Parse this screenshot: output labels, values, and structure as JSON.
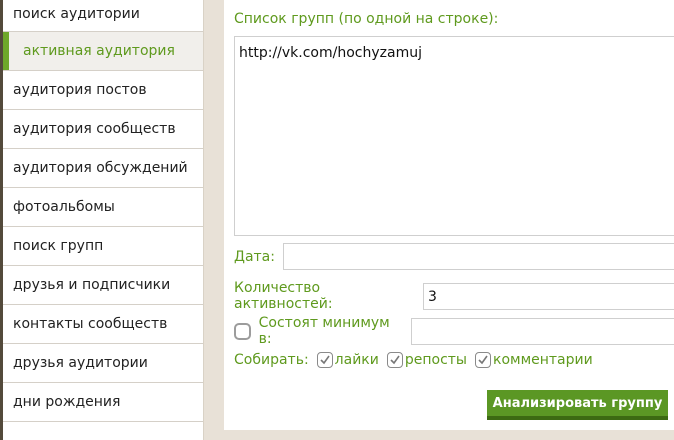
{
  "sidebar": {
    "items": [
      {
        "label": "поиск аудитории"
      },
      {
        "label": "активная аудитория"
      },
      {
        "label": "аудитория постов"
      },
      {
        "label": "аудитория сообществ"
      },
      {
        "label": "аудитория обсуждений"
      },
      {
        "label": "фотоальбомы"
      },
      {
        "label": "поиск групп"
      },
      {
        "label": "друзья и подписчики"
      },
      {
        "label": "контакты сообществ"
      },
      {
        "label": "друзья аудитории"
      },
      {
        "label": "дни рождения"
      },
      {
        "label": ""
      }
    ]
  },
  "form": {
    "list_label": "Список групп (по одной на строке):",
    "list_value": "http://vk.com/hochyzamuj",
    "date_label": "Дата:",
    "date_value": "",
    "activity_label": "Количество активностей:",
    "activity_value": "3",
    "min_label": "Состоят минимум в:",
    "min_value": "",
    "collect_label": "Собирать:",
    "opt_likes": "лайки",
    "opt_reposts": "репосты",
    "opt_comments": "комментарии",
    "analyze_button": "Анализировать группу"
  },
  "colors": {
    "accent": "#5f9a1e",
    "button": "#5b9724"
  }
}
